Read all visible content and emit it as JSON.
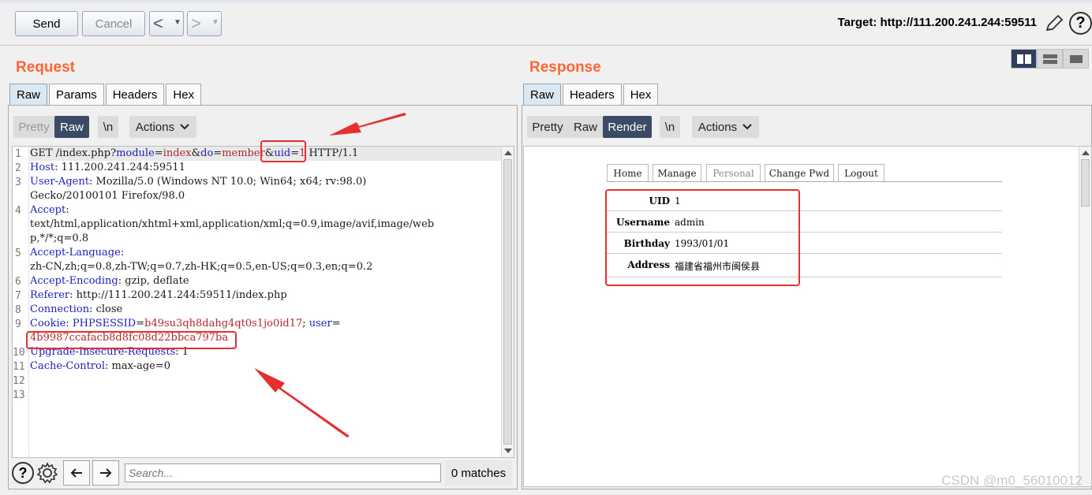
{
  "toolbar": {
    "send_label": "Send",
    "cancel_label": "Cancel",
    "back_label": "<",
    "forward_label": ">",
    "target_text": "Target: http://111.200.241.244:59511",
    "help_label": "?"
  },
  "request": {
    "title": "Request",
    "tabs": [
      "Raw",
      "Params",
      "Headers",
      "Hex"
    ],
    "view_buttons": {
      "pretty": "Pretty",
      "raw": "Raw",
      "newline": "\\n",
      "actions": "Actions"
    },
    "line_numbers": [
      "1",
      "2",
      "3",
      "",
      "4",
      "",
      "",
      "5",
      "",
      "6",
      "7",
      "8",
      "9",
      "",
      "10",
      "11",
      "12",
      "13"
    ],
    "search_placeholder": "Search...",
    "matches_text": "0 matches"
  },
  "response": {
    "title": "Response",
    "tabs": [
      "Raw",
      "Headers",
      "Hex"
    ],
    "view_buttons": {
      "pretty": "Pretty",
      "raw": "Raw",
      "render": "Render",
      "newline": "\\n",
      "actions": "Actions"
    },
    "rendered_nav": [
      "Home",
      "Manage",
      "Personal",
      "Change Pwd",
      "Logout"
    ],
    "rendered_rows": [
      {
        "label": "UID",
        "value": "1"
      },
      {
        "label": "Username",
        "value": "admin"
      },
      {
        "label": "Birthday",
        "value": "1993/01/01"
      },
      {
        "label": "Address",
        "value": "福建省福州市闽侯县"
      }
    ]
  },
  "code_lines": {
    "l1a": "GET /index.php?",
    "l1b": "module",
    "l1c": "=",
    "l1d": "index",
    "l1e": "&",
    "l1f": "do",
    "l1g": "=",
    "l1h": "member",
    "l1i": "&",
    "l1j": "uid",
    "l1k": "=",
    "l1l": "1",
    "l1m": " HTTP/1.1",
    "l2a": "Host",
    "l2b": ": 111.200.241.244:59511",
    "l3a": "User-Agent",
    "l3b": ": Mozilla/5.0 (Windows NT 10.0; Win64; x64; rv:98.0)",
    "l3c": "Gecko/20100101 Firefox/98.0",
    "l4a": "Accept",
    "l4b": ":",
    "l4c": "text/html,application/xhtml+xml,application/xml;q=0.9,image/avif,image/web",
    "l4d": "p,*/*;q=0.8",
    "l5a": "Accept-Language",
    "l5b": ":",
    "l5c": "zh-CN,zh;q=0.8,zh-TW;q=0.7,zh-HK;q=0.5,en-US;q=0.3,en;q=0.2",
    "l6a": "Accept-Encoding",
    "l6b": ": gzip, deflate",
    "l7a": "Referer",
    "l7b": ": http://111.200.241.244:59511/index.php",
    "l8a": "Connection",
    "l8b": ": close",
    "l9a": "Cookie",
    "l9b": ": ",
    "l9c": "PHPSESSID",
    "l9d": "=",
    "l9e": "b49su3qh8dahg4qt0s1jo0id17",
    "l9f": "; ",
    "l9g": "user",
    "l9h": "=",
    "l9i": "4b9987ccafacb8d8fc08d22bbca797ba",
    "l10a": "Upgrade-Insecure-Requests",
    "l10b": ": 1",
    "l11a": "Cache-Control",
    "l11b": ": max-age=0"
  },
  "watermark": "CSDN @m0_56010012",
  "colors": {
    "title_orange": "#ff6633",
    "annotation_red": "#e53030",
    "key_blue": "#1d1dbf",
    "value_red": "#b02a2a",
    "active_dark": "#3a4b63"
  },
  "icons": [
    "pencil-icon",
    "help-icon",
    "settings-gear-icon",
    "arrow-left-icon",
    "arrow-right-icon",
    "chevron-down-icon",
    "layout-icon"
  ]
}
